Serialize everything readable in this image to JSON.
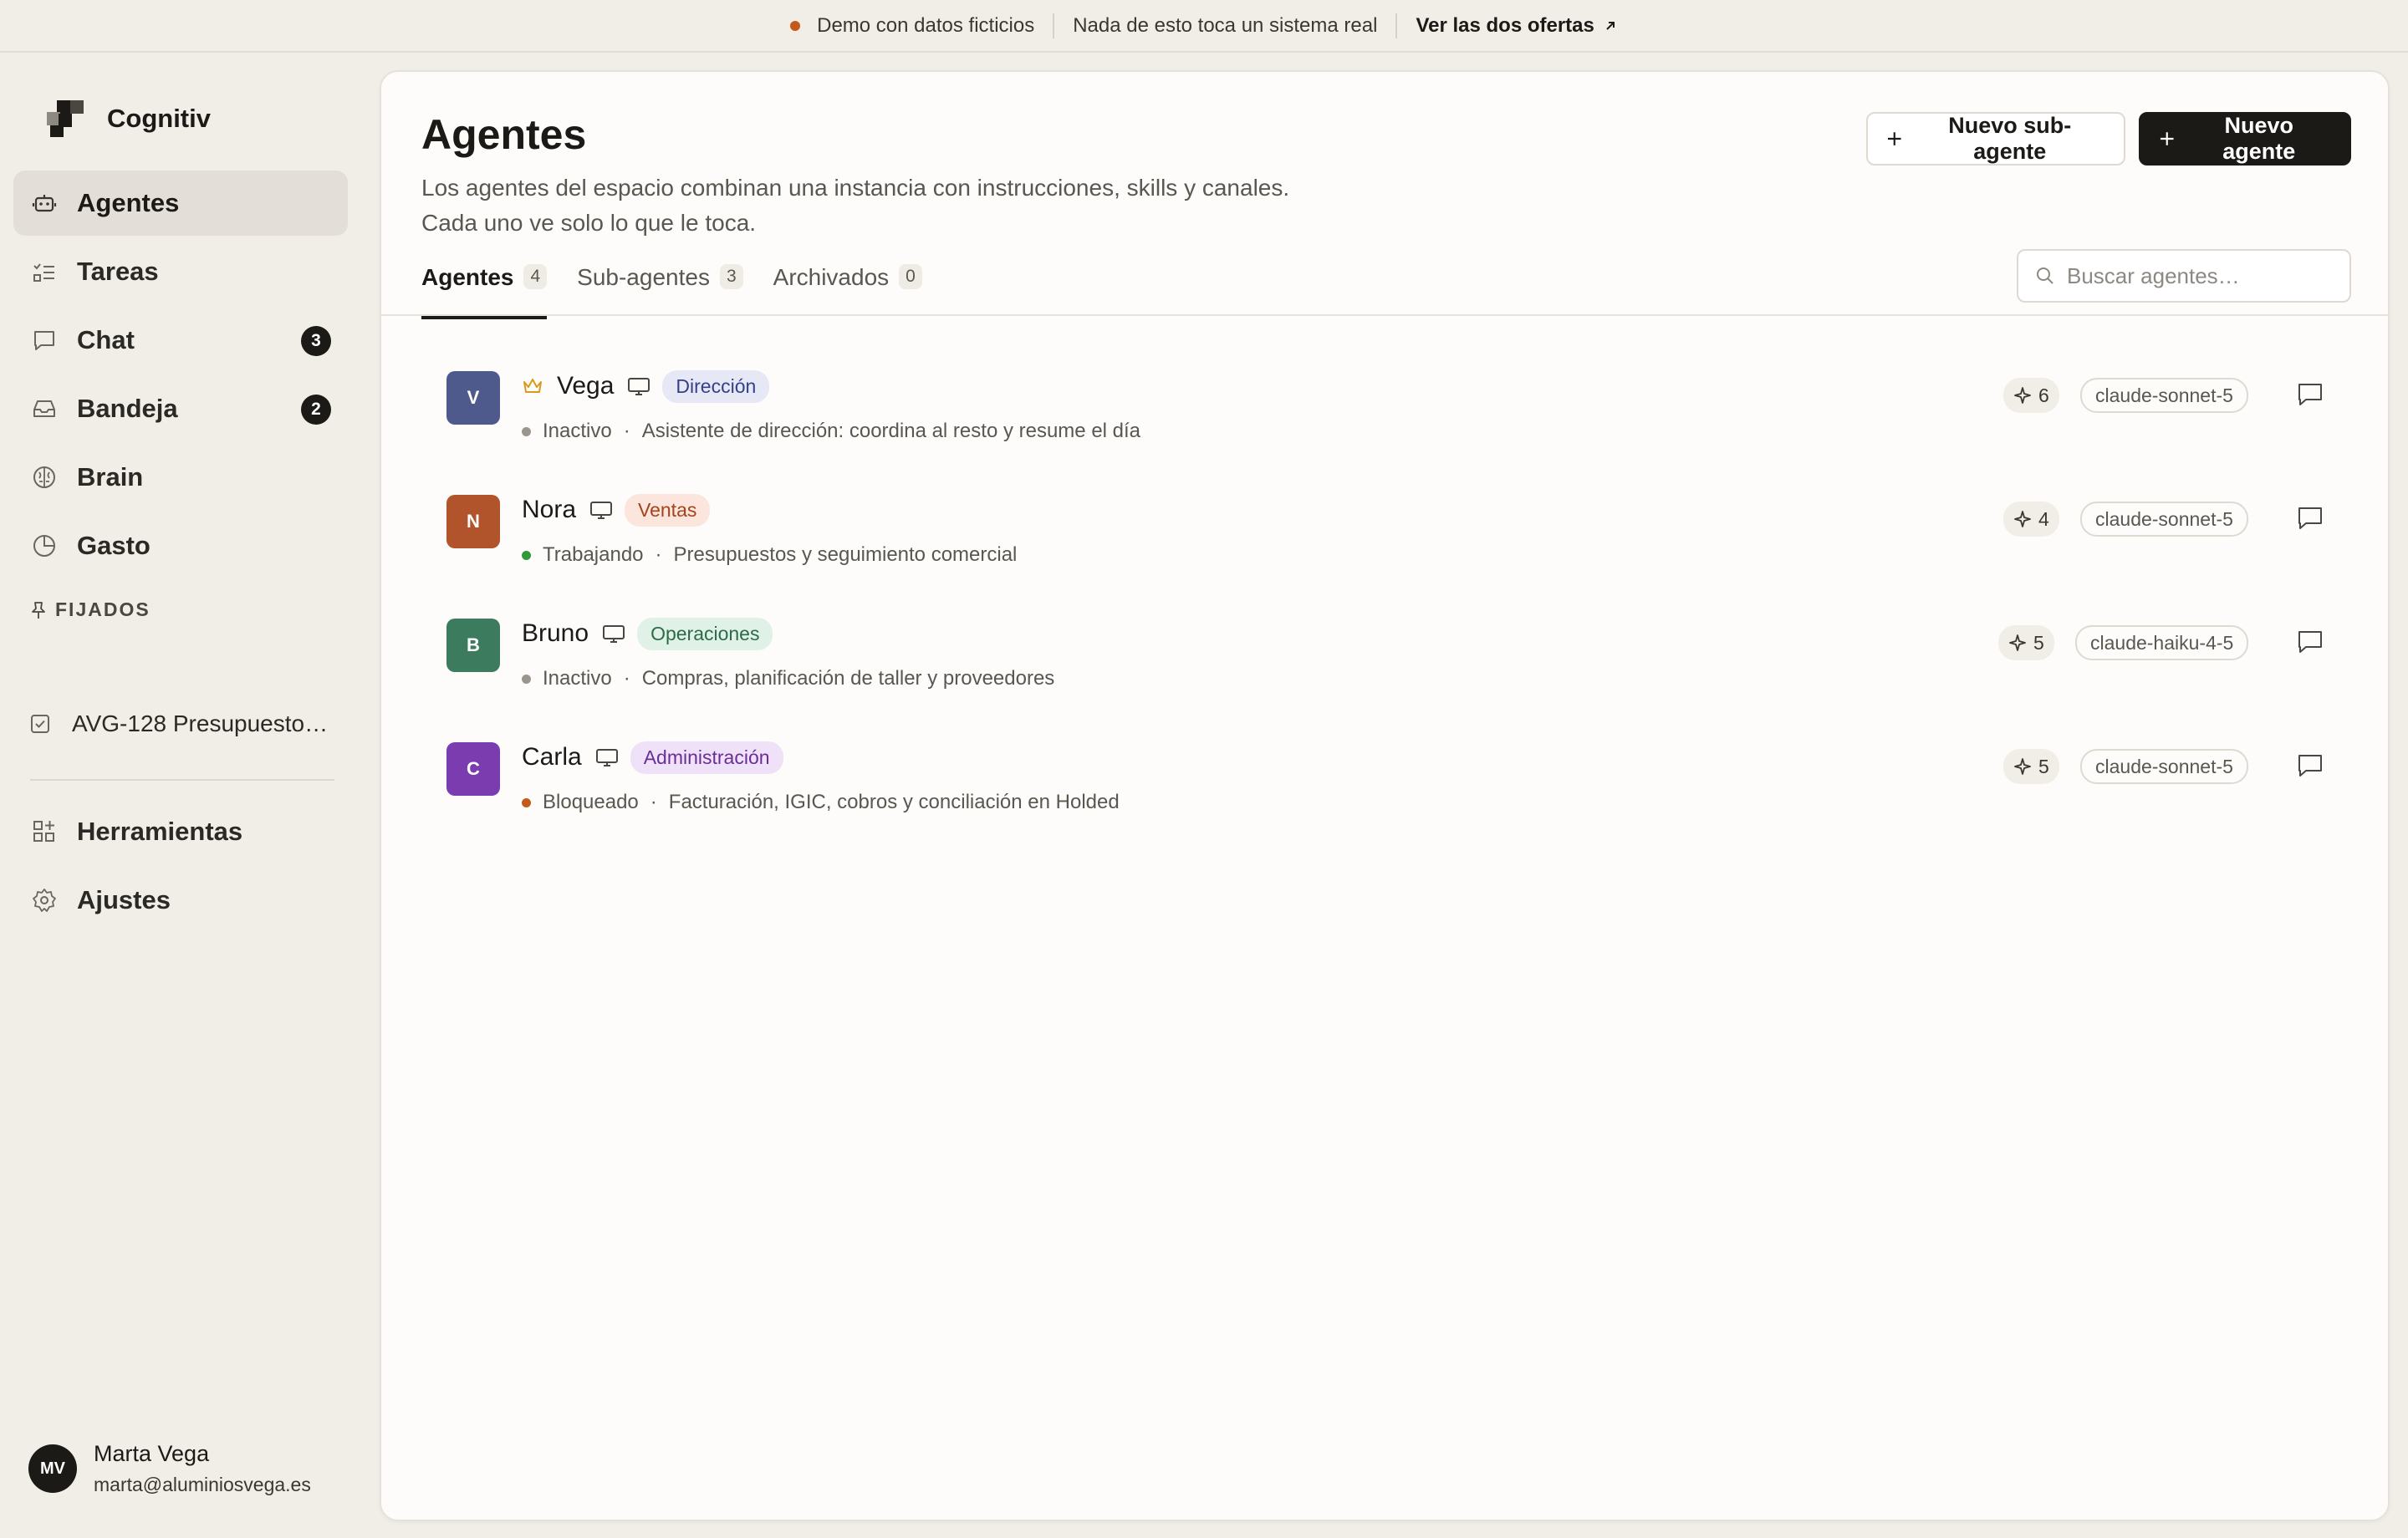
{
  "banner": {
    "dot_color": "#c4591c",
    "demo_text": "Demo con datos ficticios",
    "note_text": "Nada de esto toca un sistema real",
    "link_text": "Ver las dos ofertas"
  },
  "brand": {
    "name": "Cognitiv"
  },
  "sidebar": {
    "items": [
      {
        "label": "Agentes",
        "icon": "bot-icon",
        "active": true
      },
      {
        "label": "Tareas",
        "icon": "checklist-icon"
      },
      {
        "label": "Chat",
        "icon": "chat-icon",
        "badge": "3"
      },
      {
        "label": "Bandeja",
        "icon": "inbox-icon",
        "badge": "2"
      },
      {
        "label": "Brain",
        "icon": "brain-icon"
      },
      {
        "label": "Gasto",
        "icon": "pie-chart-icon"
      }
    ],
    "pinned_title": "FIJADOS",
    "pinned_items": [
      {
        "label": "AVG-128 Presupuesto…",
        "icon": "checkbox-icon"
      }
    ],
    "bottom_items": [
      {
        "label": "Herramientas",
        "icon": "grid-plus-icon"
      },
      {
        "label": "Ajustes",
        "icon": "gear-icon"
      }
    ]
  },
  "user": {
    "initials": "MV",
    "name": "Marta Vega",
    "email": "marta@aluminiosvega.es"
  },
  "page": {
    "title": "Agentes",
    "description_line1": "Los agentes del espacio combinan una instancia con instrucciones, skills y canales.",
    "description_line2": "Cada uno ve solo lo que le toca.",
    "btn_sub": "Nuevo sub-agente",
    "btn_new": "Nuevo agente",
    "tabs": [
      {
        "label": "Agentes",
        "count": "4",
        "active": true
      },
      {
        "label": "Sub-agentes",
        "count": "3"
      },
      {
        "label": "Archivados",
        "count": "0"
      }
    ],
    "search_placeholder": "Buscar agentes…"
  },
  "agents": [
    {
      "initial": "V",
      "name": "Vega",
      "lead": true,
      "avatar_color": "#4e5a8c",
      "tag": "Dirección",
      "tag_bg": "#e6e8f6",
      "tag_fg": "#34408a",
      "status": "Inactivo",
      "status_color": "#9a968f",
      "description": "Asistente de dirección: coordina al resto y resume el día",
      "skills": "6",
      "model": "claude-sonnet-5"
    },
    {
      "initial": "N",
      "name": "Nora",
      "lead": false,
      "avatar_color": "#b1532b",
      "tag": "Ventas",
      "tag_bg": "#fbe5dc",
      "tag_fg": "#a4431c",
      "status": "Trabajando",
      "status_color": "#2e9a3a",
      "description": "Presupuestos y seguimiento comercial",
      "skills": "4",
      "model": "claude-sonnet-5"
    },
    {
      "initial": "B",
      "name": "Bruno",
      "lead": false,
      "avatar_color": "#3c7b5e",
      "tag": "Operaciones",
      "tag_bg": "#e0f1e7",
      "tag_fg": "#2c6b48",
      "status": "Inactivo",
      "status_color": "#9a968f",
      "description": "Compras, planificación de taller y proveedores",
      "skills": "5",
      "model": "claude-haiku-4-5"
    },
    {
      "initial": "C",
      "name": "Carla",
      "lead": false,
      "avatar_color": "#7b3cb0",
      "tag": "Administración",
      "tag_bg": "#efe2f8",
      "tag_fg": "#6a2e96",
      "status": "Bloqueado",
      "status_color": "#c4591c",
      "description": "Facturación, IGIC, cobros y conciliación en Holded",
      "skills": "5",
      "model": "claude-sonnet-5"
    }
  ]
}
